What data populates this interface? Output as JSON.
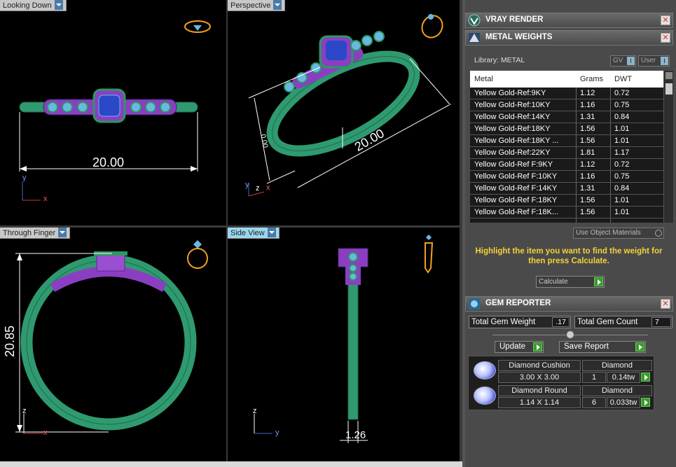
{
  "viewports": {
    "top_left": {
      "label": "Looking Down",
      "dimension": "20.00",
      "axis_v": "y",
      "axis_h": "x"
    },
    "top_right": {
      "label": "Perspective",
      "dimension_long": "20.00",
      "dimension_short": "0.00",
      "axis_v": "y",
      "axis_z": "z",
      "axis_h": "x"
    },
    "bottom_left": {
      "label": "Through Finger",
      "dimension": "20.85",
      "axis_v": "z",
      "axis_h": "x"
    },
    "bottom_right": {
      "label": "Side View",
      "dimension": "1.26",
      "axis_v": "z",
      "axis_h": "y"
    }
  },
  "panel": {
    "vray": {
      "title": "VRAY RENDER",
      "close": "✕"
    },
    "metal": {
      "title": "METAL WEIGHTS",
      "close": "✕",
      "library_label": "Library: METAL",
      "gv_label": "GV",
      "user_label": "User",
      "headers": {
        "metal": "Metal",
        "grams": "Grams",
        "dwt": "DWT"
      },
      "rows": [
        {
          "metal": "Yellow Gold-Ref:9KY",
          "grams": "1.12",
          "dwt": "0.72"
        },
        {
          "metal": "Yellow Gold-Ref:10KY",
          "grams": "1.16",
          "dwt": "0.75"
        },
        {
          "metal": "Yellow Gold-Ref:14KY",
          "grams": "1.31",
          "dwt": "0.84"
        },
        {
          "metal": "Yellow Gold-Ref:18KY",
          "grams": "1.56",
          "dwt": "1.01"
        },
        {
          "metal": "Yellow Gold-Ref:18KY ...",
          "grams": "1.56",
          "dwt": "1.01"
        },
        {
          "metal": "Yellow Gold-Ref:22KY",
          "grams": "1.81",
          "dwt": "1.17"
        },
        {
          "metal": "Yellow Gold-Ref F:9KY",
          "grams": "1.12",
          "dwt": "0.72"
        },
        {
          "metal": "Yellow Gold-Ref F:10KY",
          "grams": "1.16",
          "dwt": "0.75"
        },
        {
          "metal": "Yellow Gold-Ref F:14KY",
          "grams": "1.31",
          "dwt": "0.84"
        },
        {
          "metal": "Yellow Gold-Ref F:18KY",
          "grams": "1.56",
          "dwt": "1.01"
        },
        {
          "metal": "Yellow Gold-Ref F:18K...",
          "grams": "1.56",
          "dwt": "1.01"
        }
      ],
      "use_object_materials": "Use Object Materials",
      "hint": "Highlight the item you want to find the weight for then press Calculate.",
      "calculate": "Calculate"
    },
    "gem": {
      "title": "GEM REPORTER",
      "close": "✕",
      "total_weight_label": "Total Gem Weight",
      "total_weight_value": ".17",
      "total_count_label": "Total Gem Count",
      "total_count_value": "7",
      "update": "Update",
      "save_report": "Save Report",
      "items": [
        {
          "name": "Diamond Cushion",
          "type": "Diamond",
          "size": "3.00 X 3.00",
          "count": "1",
          "weight": "0.14tw"
        },
        {
          "name": "Diamond Round",
          "type": "Diamond",
          "size": "1.14 X 1.14",
          "count": "6",
          "weight": "0.033tw"
        }
      ]
    }
  },
  "colors": {
    "ring": "#2f9a70",
    "setting": "#8a3fc2",
    "stone": "#6ab8e0",
    "highlight": "#f3d23a"
  }
}
